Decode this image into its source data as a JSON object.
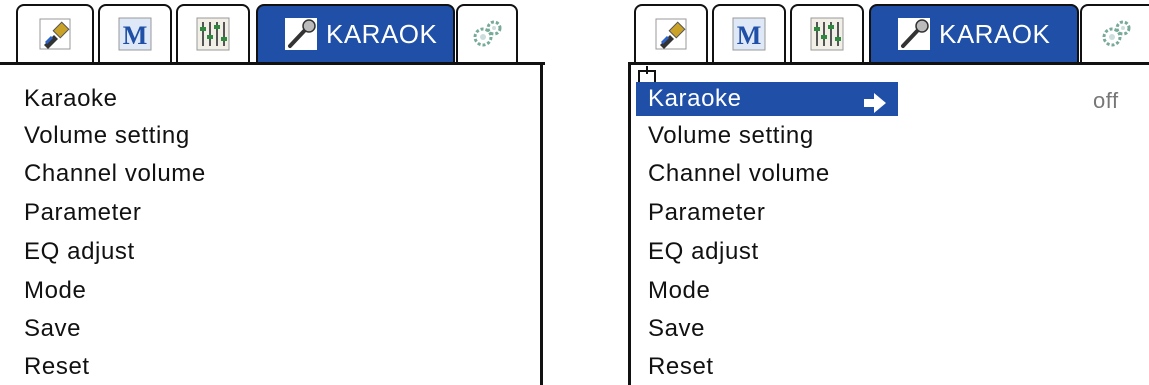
{
  "left_panel": {
    "tabs": [
      {
        "icon": "usb-cable-icon"
      },
      {
        "icon": "letter-m-icon"
      },
      {
        "icon": "equalizer-sliders-icon"
      },
      {
        "icon": "microphone-icon",
        "label": "KARAOK"
      },
      {
        "icon": "gears-icon"
      }
    ],
    "menu": [
      "Karaoke",
      "Volume setting",
      "Channel volume",
      "Parameter",
      "EQ adjust",
      "Mode",
      "Save",
      "Reset"
    ]
  },
  "right_panel": {
    "tabs": [
      {
        "icon": "usb-cable-icon"
      },
      {
        "icon": "letter-m-icon"
      },
      {
        "icon": "equalizer-sliders-icon"
      },
      {
        "icon": "microphone-icon",
        "label": "KARAOK"
      },
      {
        "icon": "gears-icon"
      }
    ],
    "menu": [
      "Karaoke",
      "Volume setting",
      "Channel volume",
      "Parameter",
      "EQ adjust",
      "Mode",
      "Save",
      "Reset"
    ],
    "selected_index": 0,
    "selected_value": "off"
  },
  "colors": {
    "accent": "#1f4fa6",
    "value_text": "#777777"
  }
}
